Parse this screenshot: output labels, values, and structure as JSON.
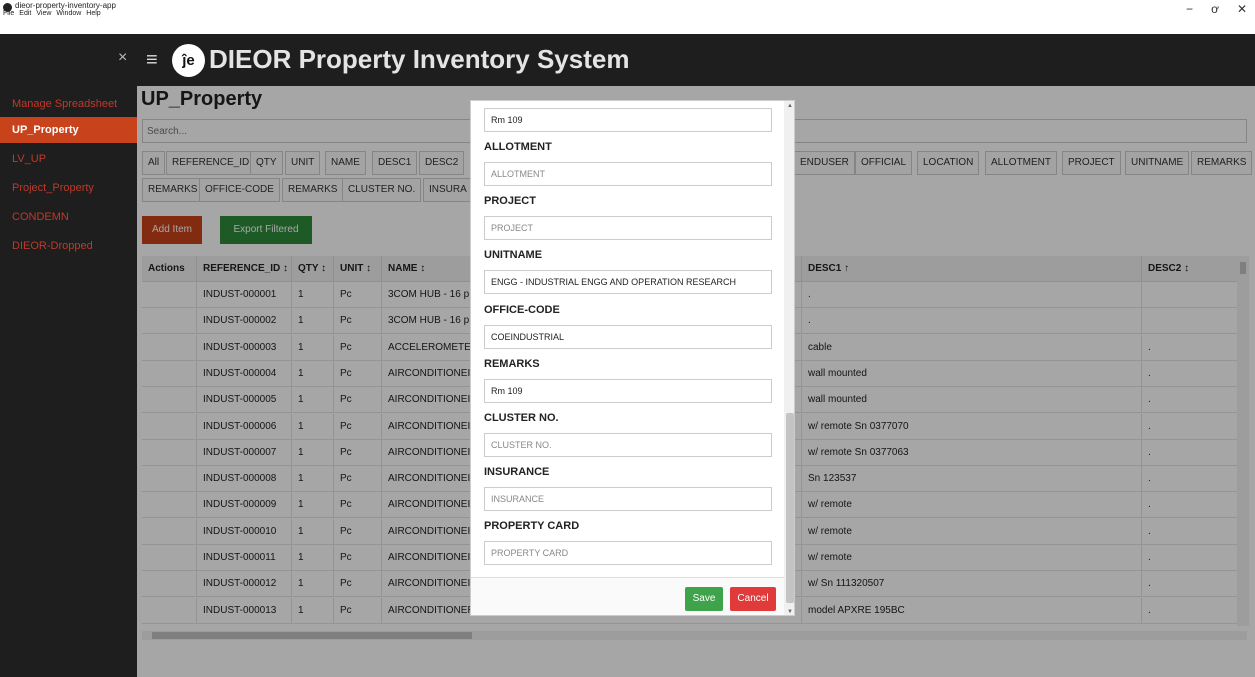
{
  "window": {
    "title": "dieor-property-inventory-app",
    "menu": [
      "File",
      "Edit",
      "View",
      "Window",
      "Help"
    ],
    "controls": {
      "minimize": "−",
      "maximize": "ơ",
      "close": "✕"
    }
  },
  "header": {
    "close": "×",
    "menu": "≡",
    "logo": "ĵe",
    "title": "DIEOR Property Inventory System"
  },
  "sidebar": {
    "items": [
      {
        "label": "Manage Spreadsheet",
        "active": false
      },
      {
        "label": "UP_Property",
        "active": true
      },
      {
        "label": "LV_UP",
        "active": false
      },
      {
        "label": "Project_Property",
        "active": false
      },
      {
        "label": "CONDEMN",
        "active": false
      },
      {
        "label": "DIEOR-Dropped",
        "active": false
      }
    ]
  },
  "main": {
    "title": "UP_Property",
    "search_placeholder": "Search...",
    "column_filters_row1": [
      "All",
      "REFERENCE_ID",
      "QTY",
      "UNIT",
      "NAME",
      "DESC1",
      "DESC2"
    ],
    "column_filters_row1_right": [
      "ENDUSER",
      "OFFICIAL",
      "LOCATION",
      "ALLOTMENT",
      "PROJECT",
      "UNITNAME",
      "REMARKS"
    ],
    "column_filters_row2": [
      "REMARKS",
      "OFFICE-CODE",
      "REMARKS",
      "CLUSTER NO.",
      "INSURA"
    ],
    "add_button": "Add Item",
    "export_button": "Export Filtered"
  },
  "table": {
    "headers": [
      "Actions",
      "REFERENCE_ID ↕",
      "QTY ↕",
      "UNIT ↕",
      "NAME ↕",
      "DESC1 ↑",
      "DESC2 ↕"
    ],
    "rows": [
      {
        "id": "INDUST-000001",
        "qty": "1",
        "unit": "Pc",
        "name": "3COM HUB - 16 p",
        "desc1": ".",
        "desc2": ""
      },
      {
        "id": "INDUST-000002",
        "qty": "1",
        "unit": "Pc",
        "name": "3COM HUB - 16 p",
        "desc1": ".",
        "desc2": ""
      },
      {
        "id": "INDUST-000003",
        "qty": "1",
        "unit": "Pc",
        "name": "ACCELEROMETER",
        "desc1": "cable",
        "desc2": "."
      },
      {
        "id": "INDUST-000004",
        "qty": "1",
        "unit": "Pc",
        "name": "AIRCONDITIONEI",
        "desc1": "wall mounted",
        "desc2": "."
      },
      {
        "id": "INDUST-000005",
        "qty": "1",
        "unit": "Pc",
        "name": "AIRCONDITIONEI",
        "desc1": "wall mounted",
        "desc2": "."
      },
      {
        "id": "INDUST-000006",
        "qty": "1",
        "unit": "Pc",
        "name": "AIRCONDITIONEI",
        "desc1": "w/ remote Sn 0377070",
        "desc2": "."
      },
      {
        "id": "INDUST-000007",
        "qty": "1",
        "unit": "Pc",
        "name": "AIRCONDITIONEI",
        "desc1": "w/ remote Sn 0377063",
        "desc2": "."
      },
      {
        "id": "INDUST-000008",
        "qty": "1",
        "unit": "Pc",
        "name": "AIRCONDITIONEI",
        "desc1": "Sn 123537",
        "desc2": "."
      },
      {
        "id": "INDUST-000009",
        "qty": "1",
        "unit": "Pc",
        "name": "AIRCONDITIONEI",
        "desc1": "w/ remote",
        "desc2": "."
      },
      {
        "id": "INDUST-000010",
        "qty": "1",
        "unit": "Pc",
        "name": "AIRCONDITIONEI",
        "desc1": "w/ remote",
        "desc2": "."
      },
      {
        "id": "INDUST-000011",
        "qty": "1",
        "unit": "Pc",
        "name": "AIRCONDITIONEI",
        "desc1": "w/ remote",
        "desc2": "."
      },
      {
        "id": "INDUST-000012",
        "qty": "1",
        "unit": "Pc",
        "name": "AIRCONDITIONEI",
        "desc1": "w/ Sn 111320507",
        "desc2": "."
      },
      {
        "id": "INDUST-000013",
        "qty": "1",
        "unit": "Pc",
        "name": "AIRCONDITIONER - Carrier window type",
        "desc1": "model APXRE 195BC",
        "desc2": "."
      }
    ]
  },
  "modal": {
    "top_value": "Rm 109",
    "fields": [
      {
        "label": "ALLOTMENT",
        "value": "",
        "placeholder": "ALLOTMENT"
      },
      {
        "label": "PROJECT",
        "value": "",
        "placeholder": "PROJECT"
      },
      {
        "label": "UNITNAME",
        "value": "ENGG - INDUSTRIAL ENGG AND OPERATION RESEARCH",
        "placeholder": "UNITNAME"
      },
      {
        "label": "OFFICE-CODE",
        "value": "COEINDUSTRIAL",
        "placeholder": "OFFICE-CODE"
      },
      {
        "label": "REMARKS",
        "value": "Rm 109",
        "placeholder": "REMARKS"
      },
      {
        "label": "CLUSTER NO.",
        "value": "",
        "placeholder": "CLUSTER NO."
      },
      {
        "label": "INSURANCE",
        "value": "",
        "placeholder": "INSURANCE"
      },
      {
        "label": "PROPERTY CARD",
        "value": "",
        "placeholder": "PROPERTY CARD"
      }
    ],
    "save": "Save",
    "cancel": "Cancel"
  },
  "colors": {
    "accent": "#c8421b",
    "export": "#2e8b3a",
    "save": "#3ea34b",
    "cancel": "#e03a3a",
    "dark": "#1e1e1e"
  }
}
